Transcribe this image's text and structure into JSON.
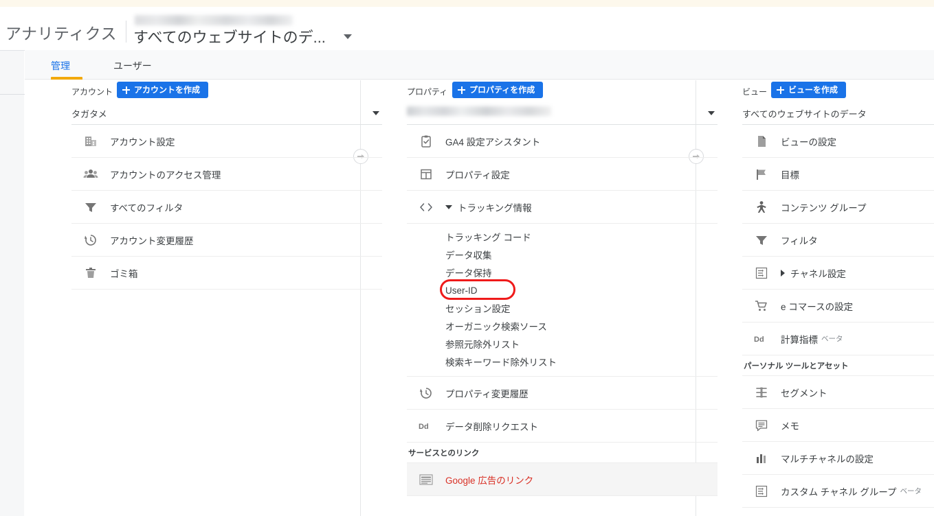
{
  "header": {
    "brand": "アナリティクス",
    "property_title": "すべてのウェブサイトのデ...",
    "redacted_account_line": "",
    "caret_icon": "chevron-down-icon"
  },
  "tabs": [
    {
      "label": "管理",
      "active": true
    },
    {
      "label": "ユーザー",
      "active": false
    }
  ],
  "accent_colors": {
    "blue": "#1a73e8",
    "orange": "#f2a90d",
    "red_link": "#d93025",
    "highlight": "#ef1a1a",
    "text": "#3c4043",
    "divider": "#ededed"
  },
  "account_column": {
    "heading": "アカウント",
    "create_label": "アカウントを作成",
    "selected": "タガタメ",
    "items": [
      {
        "label": "アカウント設定",
        "icon": "building-icon"
      },
      {
        "label": "アカウントのアクセス管理",
        "icon": "people-icon"
      },
      {
        "label": "すべてのフィルタ",
        "icon": "funnel-icon"
      },
      {
        "label": "アカウント変更履歴",
        "icon": "history-icon"
      },
      {
        "label": "ゴミ箱",
        "icon": "trash-icon"
      }
    ]
  },
  "property_column": {
    "heading": "プロパティ",
    "create_label": "プロパティを作成",
    "selected": "",
    "items": [
      {
        "label": "GA4 設定アシスタント",
        "icon": "clipboard-check-icon"
      },
      {
        "label": "プロパティ設定",
        "icon": "property-window-icon"
      },
      {
        "label": "トラッキング情報",
        "icon": "code-brackets-icon",
        "expanded": true,
        "children": [
          {
            "label": "トラッキング コード",
            "highlighted": false
          },
          {
            "label": "データ収集",
            "highlighted": false
          },
          {
            "label": "データ保持",
            "highlighted": false
          },
          {
            "label": "User-ID",
            "highlighted": true
          },
          {
            "label": "セッション設定",
            "highlighted": false
          },
          {
            "label": "オーガニック検索ソース",
            "highlighted": false
          },
          {
            "label": "参照元除外リスト",
            "highlighted": false
          },
          {
            "label": "検索キーワード除外リスト",
            "highlighted": false
          }
        ]
      },
      {
        "label": "プロパティ変更履歴",
        "icon": "history-icon"
      },
      {
        "label": "データ削除リクエスト",
        "icon": "dd-icon"
      }
    ],
    "section_label": "サービスとのリンク",
    "link_items": [
      {
        "label": "Google 広告のリンク",
        "icon": "ads-list-icon",
        "red": true,
        "hovered": true
      }
    ]
  },
  "view_column": {
    "heading": "ビュー",
    "create_label": "ビューを作成",
    "selected": "すべてのウェブサイトのデータ",
    "items": [
      {
        "label": "ビューの設定",
        "icon": "document-icon"
      },
      {
        "label": "目標",
        "icon": "flag-icon"
      },
      {
        "label": "コンテンツ グループ",
        "icon": "person-icon"
      },
      {
        "label": "フィルタ",
        "icon": "funnel-icon"
      },
      {
        "label": "チャネル設定",
        "icon": "channel-arrows-icon",
        "collapsed": true
      },
      {
        "label": "e コマースの設定",
        "icon": "cart-icon"
      },
      {
        "label": "計算指標",
        "icon": "dd-icon",
        "beta": "ベータ"
      }
    ],
    "section_label": "パーソナル ツールとアセット",
    "section_items": [
      {
        "label": "セグメント",
        "icon": "segments-icon"
      },
      {
        "label": "メモ",
        "icon": "note-icon"
      },
      {
        "label": "マルチチャネルの設定",
        "icon": "bars-icon"
      },
      {
        "label": "カスタム チャネル グループ",
        "icon": "channel-arrows-icon",
        "beta": "ベータ"
      }
    ]
  },
  "expanders": [
    {
      "name": "expand-account-column",
      "icon": "arrow-right-icon"
    },
    {
      "name": "expand-property-column",
      "icon": "arrow-right-icon"
    }
  ]
}
